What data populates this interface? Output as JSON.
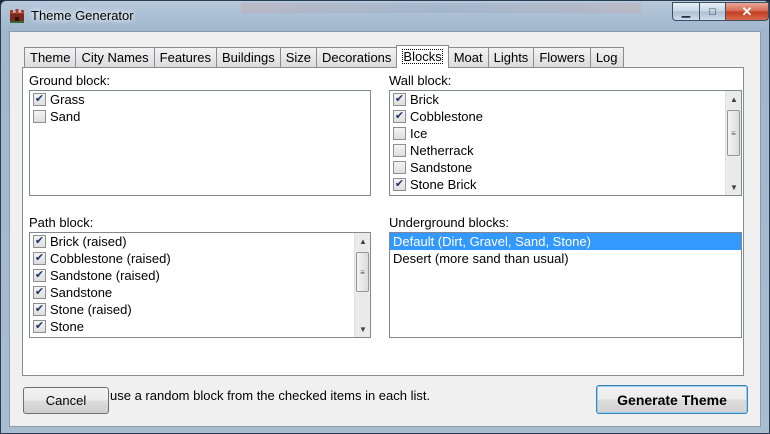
{
  "window": {
    "title": "Theme Generator"
  },
  "titlebar_buttons": {
    "minimize": "▁",
    "maximize": "□",
    "close": "✕"
  },
  "tabs": [
    {
      "label": "Theme",
      "active": false
    },
    {
      "label": "City Names",
      "active": false
    },
    {
      "label": "Features",
      "active": false
    },
    {
      "label": "Buildings",
      "active": false
    },
    {
      "label": "Size",
      "active": false
    },
    {
      "label": "Decorations",
      "active": false
    },
    {
      "label": "Blocks",
      "active": true
    },
    {
      "label": "Moat",
      "active": false
    },
    {
      "label": "Lights",
      "active": false
    },
    {
      "label": "Flowers",
      "active": false
    },
    {
      "label": "Log",
      "active": false
    }
  ],
  "ground_block": {
    "label": "Ground block:",
    "items": [
      {
        "label": "Grass",
        "checked": true
      },
      {
        "label": "Sand",
        "checked": false
      }
    ]
  },
  "wall_block": {
    "label": "Wall block:",
    "items": [
      {
        "label": "Brick",
        "checked": true
      },
      {
        "label": "Cobblestone",
        "checked": true
      },
      {
        "label": "Ice",
        "checked": false
      },
      {
        "label": "Netherrack",
        "checked": false
      },
      {
        "label": "Sandstone",
        "checked": false
      },
      {
        "label": "Stone Brick",
        "checked": true
      }
    ]
  },
  "path_block": {
    "label": "Path block:",
    "items": [
      {
        "label": "Brick (raised)",
        "checked": true
      },
      {
        "label": "Cobblestone (raised)",
        "checked": true
      },
      {
        "label": "Sandstone (raised)",
        "checked": true
      },
      {
        "label": "Sandstone",
        "checked": true
      },
      {
        "label": "Stone (raised)",
        "checked": true
      },
      {
        "label": "Stone",
        "checked": true
      }
    ]
  },
  "underground_blocks": {
    "label": "Underground blocks:",
    "items": [
      {
        "label": "Default (Dirt, Gravel, Sand, Stone)",
        "selected": true
      },
      {
        "label": "Desert (more sand than usual)",
        "selected": false
      }
    ]
  },
  "note": "Each city will use a random block from the checked items in each list.",
  "buttons": {
    "cancel": "Cancel",
    "generate": "Generate Theme"
  },
  "check_glyph": "✔",
  "scroll": {
    "up": "▲",
    "down": "▼",
    "grip": "≡"
  }
}
